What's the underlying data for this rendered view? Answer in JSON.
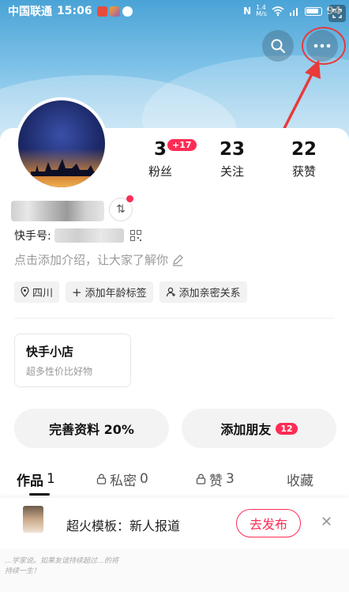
{
  "status_bar": {
    "carrier": "中国联通",
    "time": "15:06",
    "net_speed": "1.4\nM/s",
    "battery": "94"
  },
  "profile": {
    "stats": [
      {
        "value": "3",
        "label": "粉丝",
        "badge": "+17"
      },
      {
        "value": "23",
        "label": "关注"
      },
      {
        "value": "22",
        "label": "获赞"
      }
    ],
    "kuaishou_id_label": "快手号:",
    "intro_placeholder": "点击添加介绍，让大家了解你",
    "tags": [
      {
        "icon": "location-pin-icon",
        "label": "四川"
      },
      {
        "icon": "plus-icon",
        "label": "添加年龄标签"
      },
      {
        "icon": "person-icon",
        "label": "添加亲密关系"
      }
    ]
  },
  "shop": {
    "title": "快手小店",
    "subtitle": "超多性价比好物"
  },
  "actions": {
    "complete_profile": "完善资料 20%",
    "add_friend": "添加朋友",
    "add_friend_badge": "12"
  },
  "tabs": [
    {
      "label": "作品",
      "count": "1",
      "active": true
    },
    {
      "label": "私密",
      "count": "0",
      "icon": "lock-icon"
    },
    {
      "label": "赞",
      "count": "3",
      "icon": "lock-icon"
    },
    {
      "label": "收藏",
      "count": ""
    }
  ],
  "promo": {
    "text": "超火模板：新人报道",
    "button": "去发布",
    "close": "✕"
  },
  "bottom_snippet": "…学家说。如果友谊持续超过…的将持续一生！",
  "colors": {
    "accent": "#fe2c55",
    "annotation_red": "#e83a3a"
  }
}
